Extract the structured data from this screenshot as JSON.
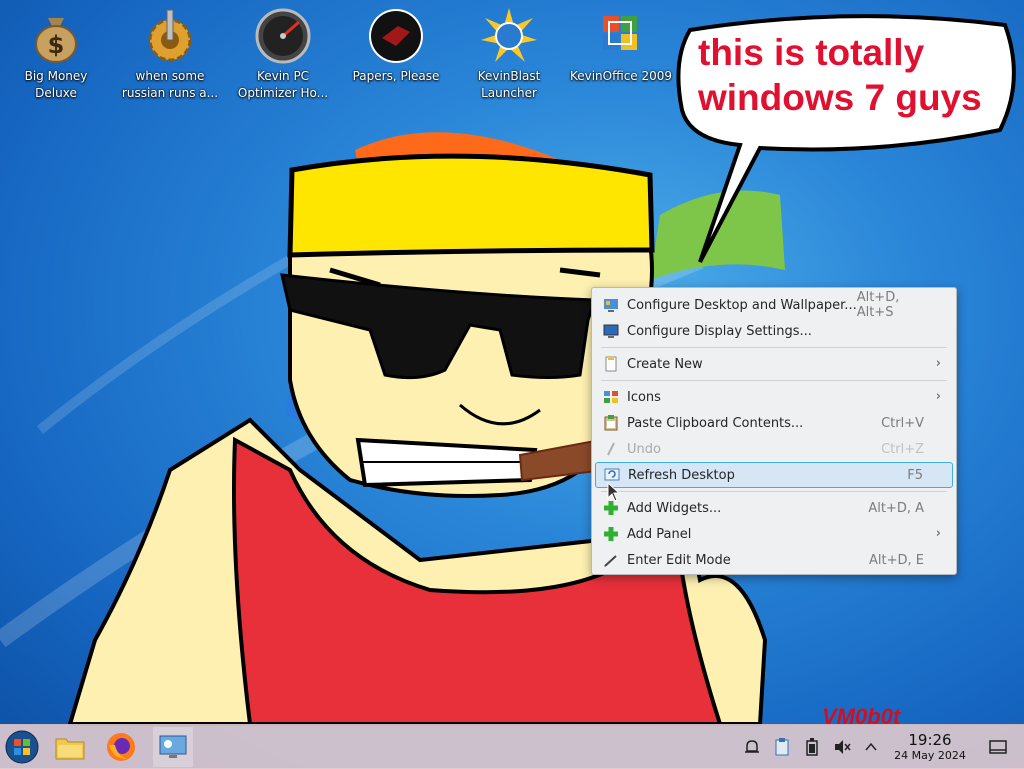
{
  "desktop": {
    "icons": [
      {
        "label": "Big Money Deluxe",
        "icon": "money-bag-icon"
      },
      {
        "label": "when some russian runs a...",
        "icon": "gear-icon"
      },
      {
        "label": "Kevin PC Optimizer Ho...",
        "icon": "speedometer-icon"
      },
      {
        "label": "Papers, Please",
        "icon": "papers-please-icon"
      },
      {
        "label": "KevinBlast Launcher",
        "icon": "globe-burst-icon"
      },
      {
        "label": "KevinOffice 2009",
        "icon": "office-icon"
      }
    ],
    "speech_bubble": "this is totally windows 7 guys",
    "watermark": "VM0b0t"
  },
  "context_menu": {
    "items": [
      {
        "label": "Configure Desktop and Wallpaper...",
        "shortcut": "Alt+D, Alt+S",
        "icon": "configure-desktop-icon",
        "enabled": true
      },
      {
        "label": "Configure Display Settings...",
        "shortcut": "",
        "icon": "display-icon",
        "enabled": true
      },
      {
        "label": "Create New",
        "shortcut": "",
        "icon": "create-new-icon",
        "submenu": true,
        "enabled": true
      },
      {
        "label": "Icons",
        "shortcut": "",
        "icon": "icons-view-icon",
        "submenu": true,
        "enabled": true
      },
      {
        "label": "Paste Clipboard Contents...",
        "shortcut": "Ctrl+V",
        "icon": "clipboard-icon",
        "enabled": true
      },
      {
        "label": "Undo",
        "shortcut": "Ctrl+Z",
        "icon": "undo-icon",
        "enabled": false
      },
      {
        "label": "Refresh Desktop",
        "shortcut": "F5",
        "icon": "refresh-icon",
        "enabled": true,
        "highlighted": true
      },
      {
        "label": "Add Widgets...",
        "shortcut": "Alt+D, A",
        "icon": "add-icon",
        "enabled": true
      },
      {
        "label": "Add Panel",
        "shortcut": "",
        "icon": "add-icon",
        "submenu": true,
        "enabled": true
      },
      {
        "label": "Enter Edit Mode",
        "shortcut": "Alt+D, E",
        "icon": "edit-mode-icon",
        "enabled": true
      }
    ]
  },
  "taskbar": {
    "launchers": [
      "start-orb-icon",
      "file-manager-icon",
      "firefox-icon",
      "system-settings-icon"
    ],
    "tray": [
      "notifications-icon",
      "clipboard-tray-icon",
      "battery-icon",
      "volume-muted-icon",
      "show-hidden-icon"
    ],
    "clock": {
      "time": "19:26",
      "date": "24 May 2024"
    }
  },
  "colors": {
    "menu_highlight": "#d6e6f5",
    "menu_highlight_border": "#3daee9",
    "bubble_text": "#e01030"
  }
}
